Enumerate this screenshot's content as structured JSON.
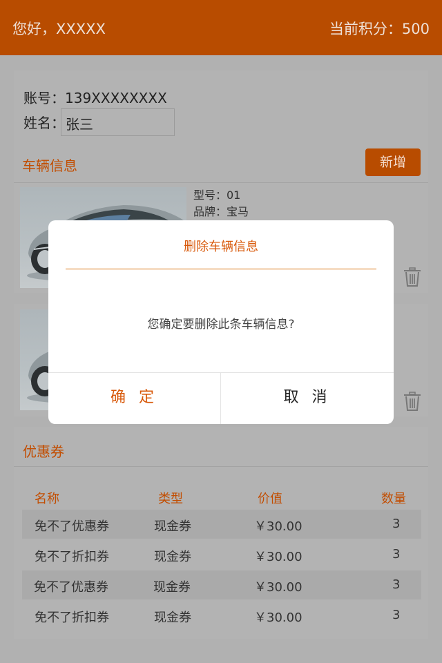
{
  "header": {
    "greeting": "您好，XXXXX",
    "points": "当前积分：500"
  },
  "account": {
    "account_label": "账号：139XXXXXXXX",
    "name_label": "姓名：",
    "name_value": "张三"
  },
  "vehicles": {
    "title": "车辆信息",
    "add_label": "新增",
    "items": [
      {
        "model": "型号：01",
        "brand": "品牌：宝马"
      },
      {
        "model": "",
        "brand": ""
      }
    ]
  },
  "coupons": {
    "title": "优惠券",
    "columns": [
      "名称",
      "类型",
      "价值",
      "数量"
    ],
    "rows": [
      [
        "免不了优惠券",
        "现金券",
        "￥30.00",
        "3"
      ],
      [
        "免不了折扣券",
        "现金券",
        "￥30.00",
        "3"
      ],
      [
        "免不了优惠券",
        "现金券",
        "￥30.00",
        "3"
      ],
      [
        "免不了折扣券",
        "现金券",
        "￥30.00",
        "3"
      ]
    ]
  },
  "dialog": {
    "title": "删除车辆信息",
    "message": "您确定要删除此条车辆信息?",
    "confirm_label": "确 定",
    "cancel_label": "取 消"
  },
  "colors": {
    "accent": "#b84c00",
    "accent_text": "#c24d00",
    "dialog_accent": "#d8590a"
  },
  "icons": {
    "delete": "trash-icon"
  }
}
